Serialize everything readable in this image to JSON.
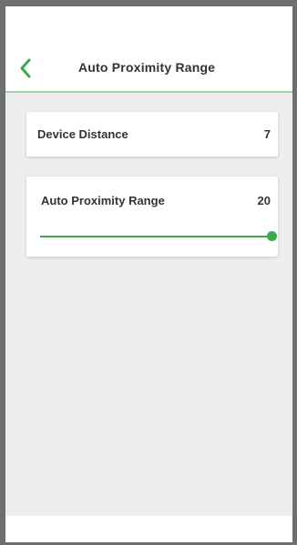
{
  "header": {
    "title": "Auto Proximity Range",
    "back_icon": "chevron-left-icon"
  },
  "settings": {
    "device_distance": {
      "label": "Device Distance",
      "value": "7"
    },
    "auto_proximity_range": {
      "label": "Auto Proximity Range",
      "value": "20",
      "slider_fraction": 1.0
    }
  },
  "colors": {
    "accent": "#3ea84f",
    "header_divider": "#9fd3a3",
    "background": "#eeeeee",
    "frame": "#6f6f6f"
  }
}
